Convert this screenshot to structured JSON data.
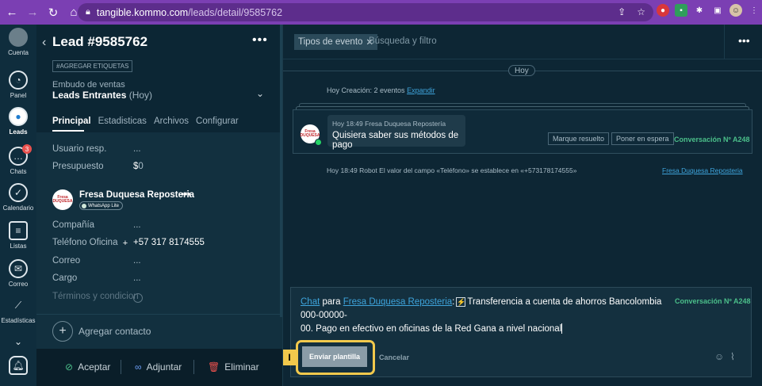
{
  "browser": {
    "url_host": "tangible.kommo.com",
    "url_path": "/leads/detail/9585762",
    "icons": [
      "back-icon",
      "forward-icon",
      "reload-icon",
      "lock-icon",
      "share-icon",
      "star-icon",
      "extension-icon",
      "profile-avatar",
      "menu-icon"
    ]
  },
  "rail": {
    "items": [
      {
        "label": "Cuenta",
        "icon": "avatar"
      },
      {
        "label": "Panel",
        "icon": "gauge-icon"
      },
      {
        "label": "Leads",
        "icon": "leads-icon"
      },
      {
        "label": "Chats",
        "icon": "chat-icon",
        "badge": "3"
      },
      {
        "label": "Calendario",
        "icon": "check-icon"
      },
      {
        "label": "Listas",
        "icon": "list-icon"
      },
      {
        "label": "Correo",
        "icon": "mail-icon"
      },
      {
        "label": "Estadísticas",
        "icon": "stats-icon"
      }
    ]
  },
  "lead": {
    "title": "Lead #9585762",
    "tag_button": "#AGREGAR ETIQUETAS",
    "funnel_label": "Embudo de ventas",
    "funnel_value": "Leads Entrantes",
    "funnel_sub": "(Hoy)",
    "tabs": [
      "Principal",
      "Estadisticas",
      "Archivos",
      "Configurar"
    ],
    "fields": {
      "resp_label": "Usuario resp.",
      "resp_value": "...",
      "budget_label": "Presupuesto",
      "budget_symbol": "$",
      "budget_value": "0"
    },
    "contact": {
      "name": "Fresa Duquesa Reposteria",
      "badge": "WhatsApp Lite",
      "logo_text": "Fresa DUQUESA",
      "company_label": "Compañía",
      "company_value": "...",
      "phone_label": "Teléfono Oficina",
      "phone_value": "+57 317 8174555",
      "email_label": "Correo",
      "email_value": "...",
      "position_label": "Cargo",
      "position_value": "...",
      "terms_label": "Términos y condicion"
    },
    "add_contact": "Agregar contacto",
    "footer": {
      "accept": "Aceptar",
      "attach": "Adjuntar",
      "delete": "Eliminar"
    }
  },
  "feed": {
    "filter_chip": "Tipos de evento",
    "search_placeholder": "Búsqueda y filtro",
    "day_label": "Hoy",
    "creation_line": "Hoy Creación: 2 eventos",
    "expand_link": "Expandir",
    "message": {
      "meta": "Hoy 18:49 Fresa Duquesa Repostería",
      "text": "Quisiera saber sus métodos de pago",
      "resolve_button": "Marque resuelto",
      "hold_button": "Poner en espera",
      "conversation": "Conversación Nº A248"
    },
    "robot_line": "Hoy 18:49 Robot El valor del campo «Teléfono» se establece en «+573178174555»",
    "robot_link": "Fresa Duquesa Reposteria"
  },
  "composer": {
    "chat_link": "Chat",
    "para": "para",
    "contact_link": "Fresa Duquesa Reposteria",
    "colon": ":",
    "bolt": "⚡",
    "text_line1": "Transferencia a cuenta de ahorros Bancolombia 000-00000-",
    "text_line2": "00. Pago en efectivo en oficinas de la Red Gana a nivel nacional",
    "conversation": "Conversación Nº A248",
    "send_button": "Enviar plantilla",
    "cancel_button": "Cancelar",
    "marker": "I"
  }
}
